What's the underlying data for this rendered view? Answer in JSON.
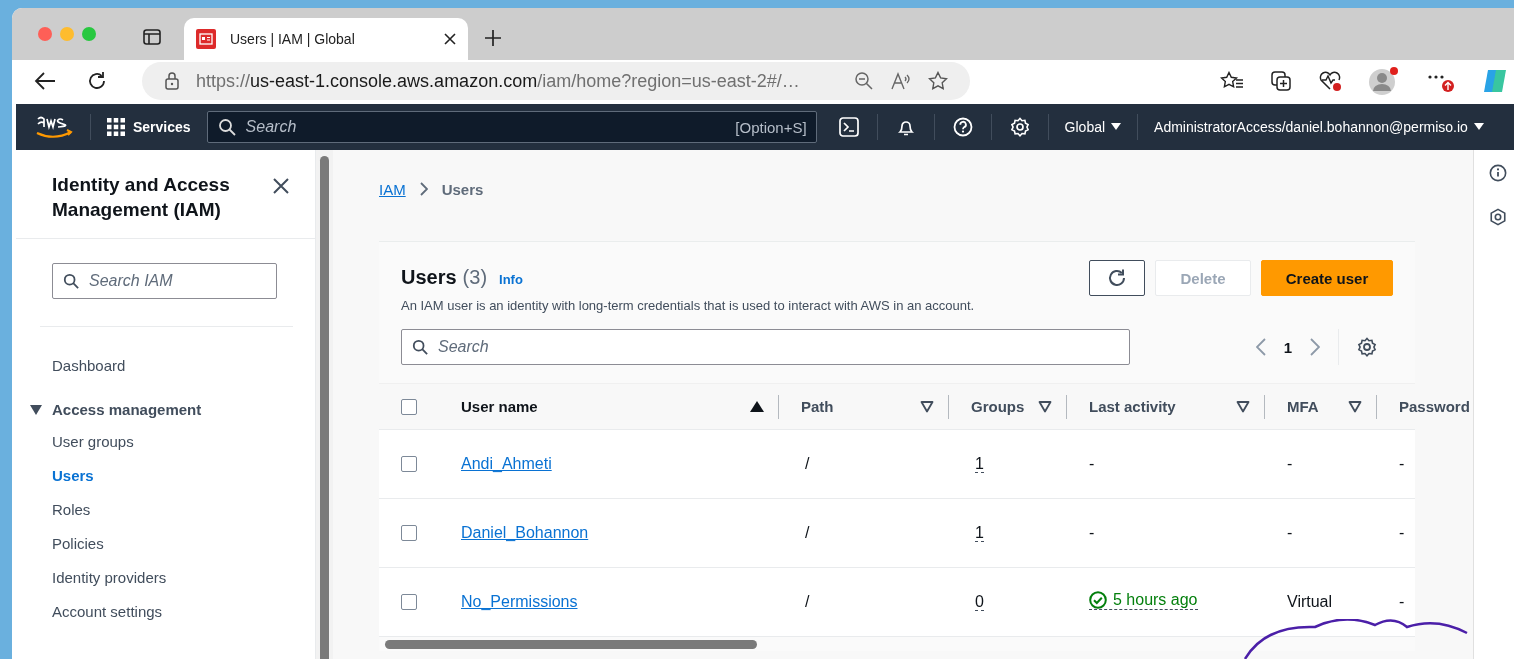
{
  "browser": {
    "tab_title": "Users | IAM | Global",
    "url_scheme": "https://",
    "url_host": "us-east-1.console.aws.amazon.com",
    "url_path": "/iam/home?region=us-east-2#/…"
  },
  "aws_nav": {
    "services": "Services",
    "search_placeholder": "Search",
    "search_shortcut": "[Option+S]",
    "region": "Global",
    "account": "AdministratorAccess/daniel.bohannon@permiso.io"
  },
  "sidebar": {
    "title": "Identity and Access Management (IAM)",
    "search_placeholder": "Search IAM",
    "items": [
      {
        "label": "Dashboard",
        "selected": false
      }
    ],
    "section": {
      "label": "Access management",
      "expanded": true,
      "children": [
        {
          "label": "User groups",
          "selected": false
        },
        {
          "label": "Users",
          "selected": true
        },
        {
          "label": "Roles",
          "selected": false
        },
        {
          "label": "Policies",
          "selected": false
        },
        {
          "label": "Identity providers",
          "selected": false
        },
        {
          "label": "Account settings",
          "selected": false
        }
      ]
    }
  },
  "breadcrumb": [
    "IAM",
    "Users"
  ],
  "users_panel": {
    "title": "Users",
    "count": "(3)",
    "info": "Info",
    "description": "An IAM user is an identity with long-term credentials that is used to interact with AWS in an account.",
    "delete_button": {
      "label": "Delete",
      "disabled": true
    },
    "create_button": "Create user",
    "search_placeholder": "Search",
    "page": "1",
    "select_all_checked": false,
    "columns": [
      {
        "label": "User name",
        "sorted": true
      },
      {
        "label": "Path",
        "sorted": false
      },
      {
        "label": "Groups",
        "sorted": false
      },
      {
        "label": "Last activity",
        "sorted": false
      },
      {
        "label": "MFA",
        "sorted": false
      },
      {
        "label": "Password"
      }
    ],
    "rows": [
      {
        "selected": false,
        "name": "Andi_Ahmeti",
        "path": "/",
        "groups": "1",
        "last_activity": {
          "text": "-",
          "ok": false
        },
        "mfa": "-",
        "password": "-"
      },
      {
        "selected": false,
        "name": "Daniel_Bohannon",
        "path": "/",
        "groups": "1",
        "last_activity": {
          "text": "-",
          "ok": false
        },
        "mfa": "-",
        "password": "-"
      },
      {
        "selected": false,
        "name": "No_Permissions",
        "path": "/",
        "groups": "0",
        "last_activity": {
          "text": "5 hours ago",
          "ok": true
        },
        "mfa": "Virtual",
        "password": "-"
      }
    ]
  }
}
